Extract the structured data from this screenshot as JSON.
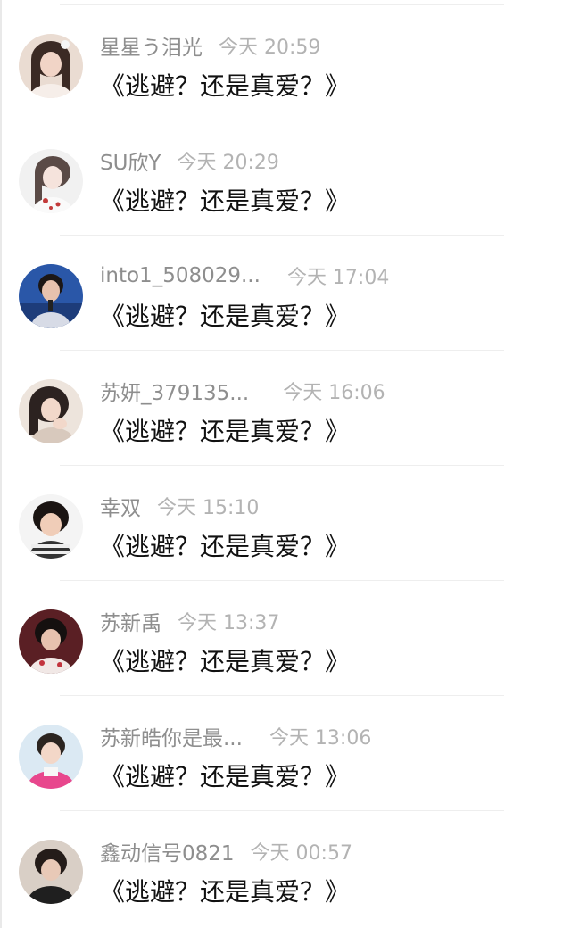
{
  "comments": [
    {
      "username": "星星う泪光",
      "time": "今天 20:59",
      "text": "《逃避？还是真爱？》",
      "avatar_icon": "avatar-photo"
    },
    {
      "username": "SU欣Y",
      "time": "今天 20:29",
      "text": "《逃避？还是真爱？》",
      "avatar_icon": "avatar-photo"
    },
    {
      "username": "into1_508029...",
      "time": "今天 17:04",
      "text": "《逃避？还是真爱？》",
      "avatar_icon": "avatar-photo"
    },
    {
      "username": "苏妍_379135...",
      "time": "今天 16:06",
      "text": "《逃避？还是真爱？》",
      "avatar_icon": "avatar-photo"
    },
    {
      "username": "幸双",
      "time": "今天 15:10",
      "text": "《逃避？还是真爱？》",
      "avatar_icon": "avatar-photo"
    },
    {
      "username": "苏新禹",
      "time": "今天 13:37",
      "text": "《逃避？还是真爱？》",
      "avatar_icon": "avatar-photo"
    },
    {
      "username": "苏新皓你是最...",
      "time": "今天 13:06",
      "text": "《逃避？还是真爱？》",
      "avatar_icon": "avatar-photo"
    },
    {
      "username": "鑫动信号0821",
      "time": "今天 00:57",
      "text": "《逃避？还是真爱？》",
      "avatar_icon": "avatar-photo"
    }
  ],
  "colors": {
    "username": "#8e8e8e",
    "timestamp": "#b3b3b3",
    "content": "#111111",
    "divider": "#eeeeee"
  }
}
